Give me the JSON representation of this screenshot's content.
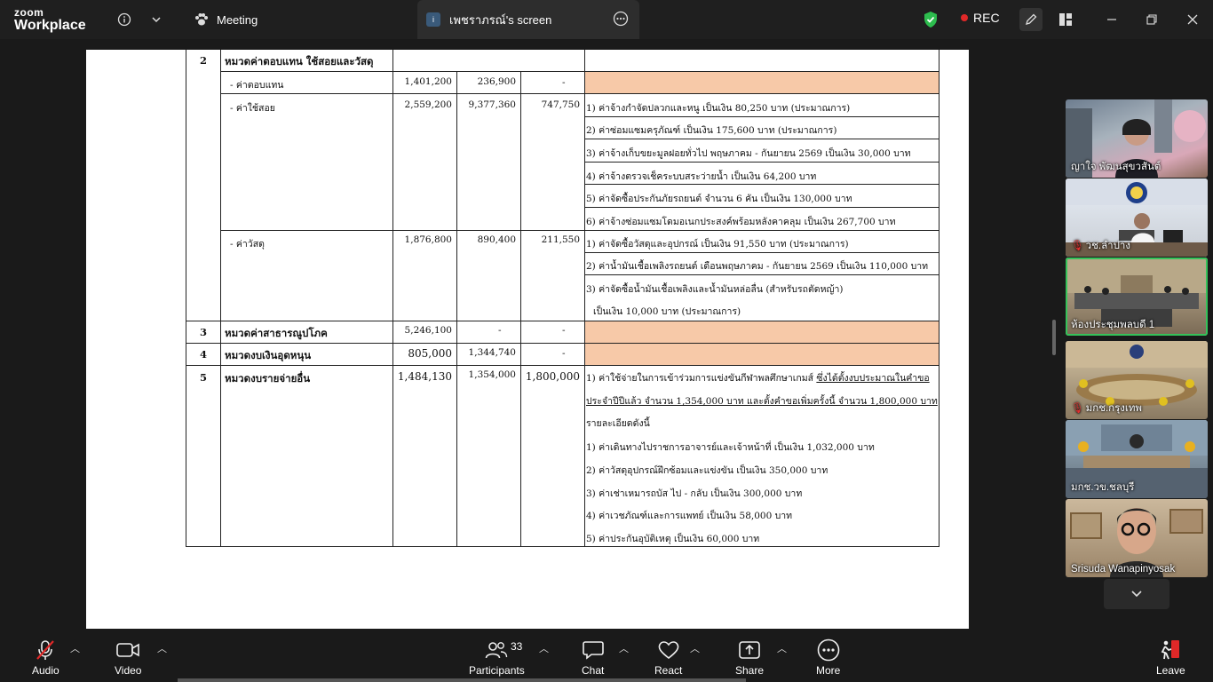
{
  "app": {
    "brand_top": "zoom",
    "brand_bottom": "Workplace"
  },
  "tabs": {
    "meeting": "Meeting",
    "share": "เพชราภรณ์'s screen",
    "share_badge": "i"
  },
  "recording": {
    "label": "REC",
    "color": "#e02828"
  },
  "colors": {
    "accent_green": "#35c25a",
    "highlight_peach": "#f7c9a8",
    "leave_red": "#e02828"
  },
  "document": {
    "rows": [
      {
        "no": "2",
        "label": "หมวดค่าตอบแทน ใช้สอยและวัสดุ"
      },
      {
        "label": "- ค่าตอบแทน",
        "v1": "1,401,200",
        "v2": "236,900",
        "v3": "-"
      },
      {
        "label": "- ค่าใช้สอย",
        "v1": "2,559,200",
        "v2": "9,377,360",
        "v3": "747,750",
        "details": [
          "1) ค่าจ้างกำจัดปลวกและหนู เป็นเงิน 80,250 บาท (ประมาณการ)",
          "2) ค่าซ่อมแซมครุภัณฑ์ เป็นเงิน 175,600 บาท (ประมาณการ)",
          "3) ค่าจ้างเก็บขยะมูลฝอยทั่วไป พฤษภาคม - กันยายน 2569 เป็นเงิน 30,000 บาท",
          "4) ค่าจ้างตรวจเช็คระบบสระว่ายน้ำ เป็นเงิน 64,200 บาท",
          "5) ค่าจัดซื้อประกันภัยรถยนต์ จำนวน 6 คัน เป็นเงิน 130,000 บาท",
          "6) ค่าจ้างซ่อมแซมโดมอเนกประสงค์พร้อมหลังคาคลุม เป็นเงิน 267,700 บาท"
        ]
      },
      {
        "label": "- ค่าวัสดุ",
        "v1": "1,876,800",
        "v2": "890,400",
        "v3": "211,550",
        "details": [
          "1) ค่าจัดซื้อวัสดุและอุปกรณ์ เป็นเงิน 91,550 บาท (ประมาณการ)",
          "2) ค่าน้ำมันเชื้อเพลิงรถยนต์ เดือนพฤษภาคม - กันยายน 2569 เป็นเงิน 110,000 บาท",
          "3) ค่าจัดซื้อน้ำมันเชื้อเพลิงและน้ำมันหล่อลื่น (สำหรับรถตัดหญ้า)",
          "เป็นเงิน 10,000 บาท (ประมาณการ)"
        ]
      },
      {
        "no": "3",
        "label": "หมวดค่าสาธารณูปโภค",
        "v1": "5,246,100",
        "v2": "-",
        "v3": "-"
      },
      {
        "no": "4",
        "label": "หมวดงบเงินอุดหนุน",
        "v1": "805,000",
        "v2": "1,344,740",
        "v3": "-"
      },
      {
        "no": "5",
        "label": "หมวดงบรายจ่ายอื่น",
        "v1": "1,484,130",
        "v2": "1,354,000",
        "v3": "1,800,000",
        "details": [
          "1) ค่าใช้จ่ายในการเข้าร่วมการแข่งขันกีฬาพลศึกษาเกมส์ ",
          "ซึ่งได้ตั้งงบประมาณในคำขอ",
          "ประจำปีปีแล้ว จำนวน 1,354,000 บาท และตั้งคำขอเพิ่มครั้งนี้ จำนวน 1,800,000 บาท",
          "รายละเอียดดังนี้",
          "1) ค่าเดินทางไปราชการอาจารย์และเจ้าหน้าที่ เป็นเงิน 1,032,000 บาท",
          "2) ค่าวัสดุอุปกรณ์ฝึกซ้อมและแข่งขัน เป็นเงิน 350,000 บาท",
          "3) ค่าเช่าเหมารถบัส ไป - กลับ เป็นเงิน 300,000 บาท",
          "4) ค่าเวชภัณฑ์และการแพทย์ เป็นเงิน 58,000 บาท",
          "5) ค่าประกันอุบัติเหตุ เป็นเงิน 60,000 บาท"
        ]
      }
    ]
  },
  "participants_panel": [
    {
      "name": "ญาใจ พัฒนสุขวสันต์",
      "muted": false
    },
    {
      "name": "วช.ลำปาง",
      "muted": true
    },
    {
      "name": "ห้องประชุมพลบดี 1",
      "muted": false,
      "active": true
    },
    {
      "name": "มกช.กรุงเทพ",
      "muted": true
    },
    {
      "name": "มกช.วข.ชลบุรี",
      "muted": false
    },
    {
      "name": "Srisuda Wanapinyosak",
      "muted": false
    }
  ],
  "toolbar": {
    "audio": "Audio",
    "video": "Video",
    "participants": "Participants",
    "participants_count": "33",
    "chat": "Chat",
    "react": "React",
    "share": "Share",
    "more": "More",
    "leave": "Leave"
  }
}
